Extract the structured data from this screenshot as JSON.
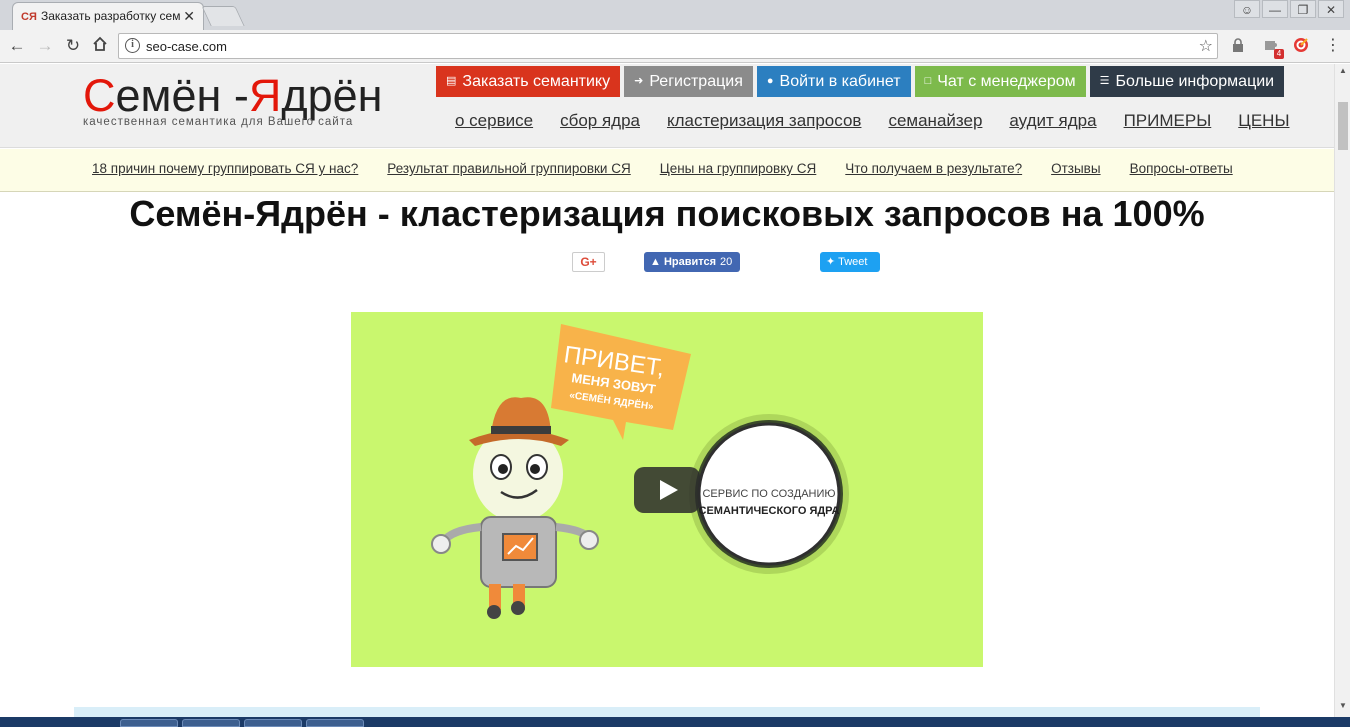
{
  "browser": {
    "tab_title": "Заказать разработку сем",
    "tab_favicon": "СЯ",
    "tab_close": "✕",
    "url": "seo-case.com",
    "extension_badge": "4"
  },
  "header": {
    "logo_first_letter": "С",
    "logo_part1": "емён -",
    "logo_second_letter": "Я",
    "logo_part2": "дрён",
    "tagline": "качественная семантика для Вашего сайта",
    "top_buttons": [
      {
        "label": "Заказать семантику",
        "icon": "list-icon",
        "color": "#d9341d"
      },
      {
        "label": "Регистрация",
        "icon": "login-icon",
        "color": "#8b8b8b"
      },
      {
        "label": "Войти в кабинет",
        "icon": "user-icon",
        "color": "#2c7fc0"
      },
      {
        "label": "Чат с менеджером",
        "icon": "chat-icon",
        "color": "#7dba4c"
      },
      {
        "label": "Больше информации",
        "icon": "menu-icon",
        "color": "#2f3b48"
      }
    ],
    "main_nav": [
      "о сервисе",
      "сбор ядра",
      "кластеризация запросов",
      "семанайзер",
      "аудит ядра",
      "ПРИМЕРЫ",
      "ЦЕНЫ"
    ]
  },
  "subnav": [
    "18 причин почему группировать СЯ у нас?",
    "Результат правильной группировки СЯ",
    "Цены на группировку СЯ",
    "Что получаем в результате?",
    "Отзывы",
    "Вопросы-ответы"
  ],
  "main": {
    "title": "Семён-Ядрён - кластеризация поисковых запросов на 100%"
  },
  "social": {
    "gplus_label": "G+",
    "fb_label": "Нравится",
    "fb_count": "20",
    "tweet_label": "Tweet"
  },
  "video": {
    "bubble_line1": "ПРИВЕТ,",
    "bubble_line2": "МЕНЯ ЗОВУТ",
    "bubble_line3": "«СЕМЁН ЯДРЁН»",
    "badge_line1": "СЕРВИС ПО СОЗДАНИЮ",
    "badge_line2": "СЕМАНТИЧЕСКОГО ЯДРА",
    "background_color": "#c9f76e"
  }
}
